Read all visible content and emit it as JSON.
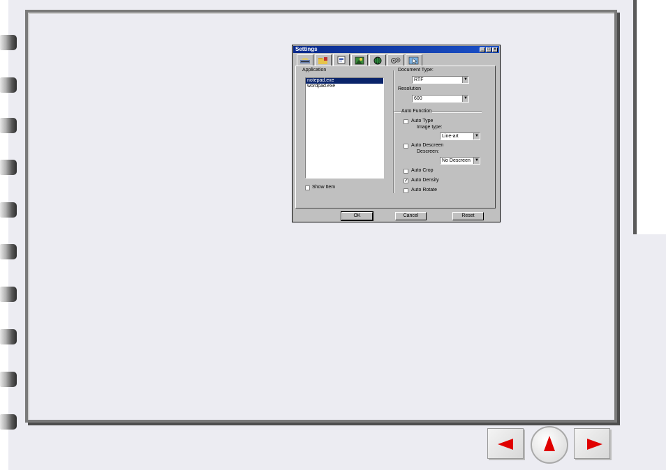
{
  "dialog": {
    "title": "Settings",
    "title_buttons": {
      "minimize": "_",
      "maximize": "□",
      "close": "×"
    },
    "tabs": [
      {
        "icon": "scanner-tab-icon"
      },
      {
        "icon": "folder-tab-icon"
      },
      {
        "icon": "document-tab-icon"
      },
      {
        "icon": "image-tab-icon"
      },
      {
        "icon": "globe-tab-icon"
      },
      {
        "icon": "gears-tab-icon"
      },
      {
        "icon": "cursor-tab-icon"
      }
    ],
    "application_label": "Application",
    "applications": [
      "notepad.exe",
      "wordpad.exe"
    ],
    "selected_application": "notepad.exe",
    "show_item_label": "Show Item",
    "show_item_checked": false,
    "document_type_label": "Document Type:",
    "document_type_value": "RTF",
    "resolution_label": "Resolution",
    "resolution_value": "600",
    "auto_function_label": "Auto Function",
    "auto_type_label": "Auto Type",
    "auto_type_checked": false,
    "image_type_label": "Image type:",
    "image_type_value": "Line-art",
    "auto_descreen_label": "Auto Descreen",
    "auto_descreen_checked": false,
    "descreen_label": "Descreen:",
    "descreen_value": "No Descreen",
    "auto_crop_label": "Auto Crop",
    "auto_crop_checked": false,
    "auto_density_label": "Auto Density",
    "auto_density_checked": true,
    "auto_rotate_label": "Auto Rotate",
    "auto_rotate_checked": false,
    "ok_label": "OK",
    "cancel_label": "Cancel",
    "reset_label": "Reset",
    "check_mark": "✓",
    "dropdown_arrow": "▼"
  },
  "nav": {
    "prev": "previous-page",
    "up": "contents",
    "next": "next-page"
  },
  "colors": {
    "page_bg": "#ececf2",
    "frame": "#7a7a7a",
    "titlebar": "#0a2a8c",
    "nav_arrow": "#e00000"
  }
}
